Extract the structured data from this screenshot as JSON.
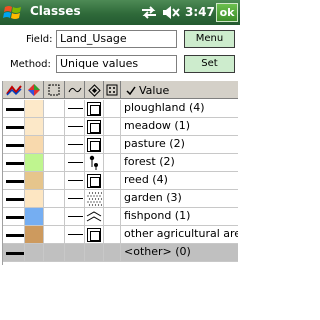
{
  "titlebar": {
    "title": "Classes",
    "time": "3:47",
    "ok_label": "ok",
    "start_icon": "windows-start-icon",
    "sync_icon": "connectivity-icon",
    "volume_icon": "speaker-muted-icon",
    "bar_color": "#2f6a3a"
  },
  "form": {
    "field_label": "Field:",
    "field_value": "Land_Usage",
    "menu_label": "Menu",
    "method_label": "Method:",
    "method_value": "Unique values",
    "set_label": "Set"
  },
  "table": {
    "header": {
      "value_label": "Value",
      "icons": [
        "line-style-icon",
        "fill-color-icon",
        "label-icon",
        "line-icon",
        "area-symbol-icon",
        "point-symbol-icon"
      ],
      "checkbox": "checkmark-icon"
    },
    "rows": [
      {
        "value": "ploughland (4)",
        "color": "#fde9c9",
        "symbol": "square"
      },
      {
        "value": "meadow (1)",
        "color": "#fce8c8",
        "symbol": "square"
      },
      {
        "value": "pasture (2)",
        "color": "#f8d9ad",
        "symbol": "square"
      },
      {
        "value": "forest (2)",
        "color": "#bff58f",
        "symbol": "tree"
      },
      {
        "value": "reed (4)",
        "color": "#e6c58c",
        "symbol": "square"
      },
      {
        "value": "garden (3)",
        "color": "#fde6c2",
        "symbol": "dots"
      },
      {
        "value": "fishpond (1)",
        "color": "#75aef2",
        "symbol": "waves"
      },
      {
        "value": "other agricultural are",
        "color": "#cd9a5e",
        "symbol": "square"
      },
      {
        "value": "<other> (0)",
        "color": "#c0c0c0",
        "symbol": "none"
      }
    ]
  }
}
